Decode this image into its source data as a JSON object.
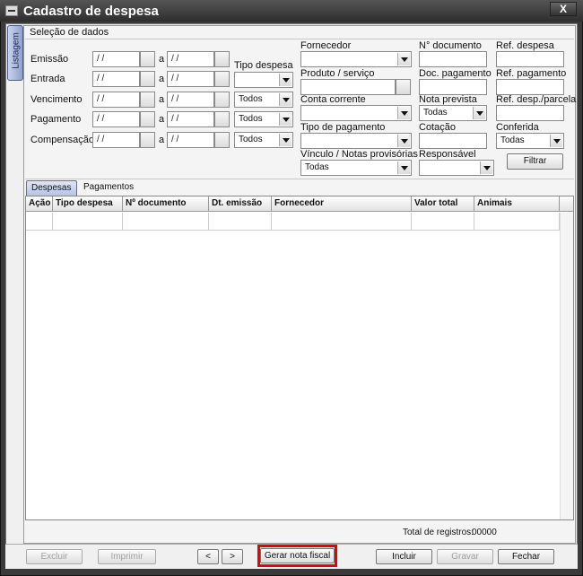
{
  "window": {
    "title": "Cadastro de despesa",
    "close_label": "X"
  },
  "side_tab": {
    "label": "Listagem"
  },
  "section": {
    "title": "Seleção de dados"
  },
  "dates": {
    "separator": "a",
    "rows": [
      {
        "label": "Emissão",
        "from": "/ /",
        "to": "/ /"
      },
      {
        "label": "Entrada",
        "from": "/ /",
        "to": "/ /"
      },
      {
        "label": "Vencimento",
        "from": "/ /",
        "to": "/ /"
      },
      {
        "label": "Pagamento",
        "from": "/ /",
        "to": "/ /"
      },
      {
        "label": "Compensação",
        "from": "/ /",
        "to": "/ /"
      }
    ]
  },
  "tipo_despesa": {
    "label": "Tipo despesa",
    "value": ""
  },
  "selects_mid": [
    {
      "value": "Todos"
    },
    {
      "value": "Todos"
    },
    {
      "value": "Todos"
    }
  ],
  "fornecedor": {
    "label": "Fornecedor",
    "value": ""
  },
  "produto": {
    "label": "Produto / serviço",
    "value": ""
  },
  "conta": {
    "label": "Conta corrente",
    "value": ""
  },
  "tipo_pagamento": {
    "label": "Tipo de pagamento",
    "value": ""
  },
  "vinculo": {
    "label": "Vínculo / Notas provisórias",
    "value": "Todas"
  },
  "num_documento": {
    "label": "N° documento",
    "value": ""
  },
  "doc_pagamento": {
    "label": "Doc. pagamento",
    "value": ""
  },
  "nota_prevista": {
    "label": "Nota prevista",
    "value": "Todas"
  },
  "cotacao": {
    "label": "Cotação",
    "value": ""
  },
  "responsavel": {
    "label": "Responsável",
    "value": ""
  },
  "ref_despesa": {
    "label": "Ref. despesa",
    "value": ""
  },
  "ref_pagamento": {
    "label": "Ref. pagamento",
    "value": ""
  },
  "ref_parcela": {
    "label": "Ref. desp./parcela",
    "value": ""
  },
  "conferida": {
    "label": "Conferida",
    "value": "Todas"
  },
  "filtrar": {
    "label": "Filtrar"
  },
  "tabs": [
    {
      "label": "Despesas"
    },
    {
      "label": "Pagamentos"
    }
  ],
  "grid": {
    "columns": [
      "Ação",
      "Tipo despesa",
      "Nº documento",
      "Dt. emissão",
      "Fornecedor",
      "Valor total",
      "Animais"
    ]
  },
  "total": {
    "label": "Total de registros:",
    "value": "00000"
  },
  "bottom": {
    "excluir": "Excluir",
    "imprimir": "Imprimir",
    "prev": "<",
    "next": ">",
    "gerar": "Gerar nota fiscal",
    "incluir": "Incluir",
    "gravar": "Gravar",
    "fechar": "Fechar"
  }
}
